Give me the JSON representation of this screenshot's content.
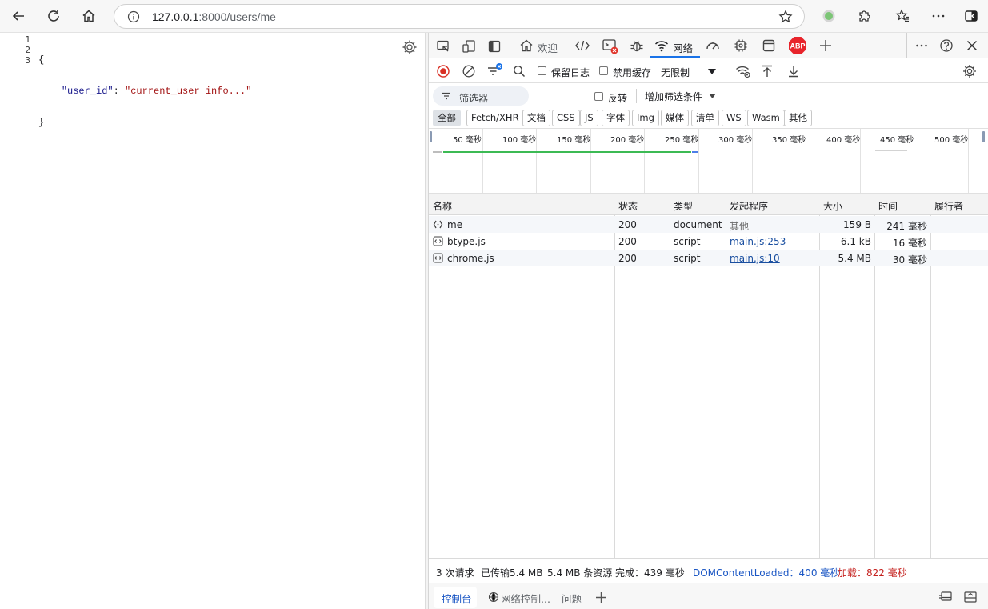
{
  "browser": {
    "url_host": "127.0.0.1",
    "url_rest": ":8000/users/me",
    "icons": [
      "back-icon",
      "reload-icon",
      "home-icon",
      "info-icon",
      "star-icon",
      "extension-green-icon",
      "puzzle-icon",
      "favorites-icon",
      "more-icon",
      "sidebar-icon"
    ]
  },
  "page": {
    "lines": [
      "1",
      "2",
      "3"
    ],
    "open_brace": "{",
    "key": "\"user_id\"",
    "colon": ": ",
    "value": "\"current_user info...\"",
    "close_brace": "}"
  },
  "devtools": {
    "tabs": {
      "welcome": "欢迎",
      "network": "网络"
    },
    "toolbar": {
      "preserve_log": "保留日志",
      "disable_cache": "禁用缓存",
      "throttle": "无限制"
    },
    "filter": {
      "placeholder": "筛选器",
      "invert": "反转",
      "more_filters": "增加筛选条件"
    },
    "types": [
      "全部",
      "Fetch/XHR",
      "文档",
      "CSS",
      "JS",
      "字体",
      "Img",
      "媒体",
      "清单",
      "WS",
      "Wasm",
      "其他"
    ],
    "timeline": {
      "ticks": [
        "50  毫秒",
        "100  毫秒",
        "150  毫秒",
        "200  毫秒",
        "250  毫秒",
        "300  毫秒",
        "350  毫秒",
        "400  毫秒",
        "450  毫秒",
        "500  毫秒"
      ]
    },
    "columns": [
      "名称",
      "状态",
      "类型",
      "发起程序",
      "大小",
      "时间",
      "履行者"
    ],
    "rows": [
      {
        "name": "me",
        "status": "200",
        "type": "document",
        "initiator": "其他",
        "size": "159 B",
        "time": "241  毫秒"
      },
      {
        "name": "btype.js",
        "status": "200",
        "type": "script",
        "initiator": "main.js:253",
        "size": "6.1 kB",
        "time": "16  毫秒"
      },
      {
        "name": "chrome.js",
        "status": "200",
        "type": "script",
        "initiator": "main.js:10",
        "size": "5.4 MB",
        "time": "30  毫秒"
      }
    ],
    "status": {
      "requests": "3 次请求",
      "transferred": "已传输5.4 MB",
      "resources": "5.4 MB 条资源",
      "finish": "完成：439  毫秒",
      "dcl": "DOMContentLoaded：400  毫秒",
      "load": "加载：822  毫秒"
    },
    "drawer": {
      "console": "控制台",
      "network_conditions": "网络控制...",
      "issues": "问题"
    },
    "colors": {
      "accent": "#1a73e8",
      "record": "#d93025",
      "abp": "#e8242b",
      "waterfall": "#3cba54"
    }
  }
}
